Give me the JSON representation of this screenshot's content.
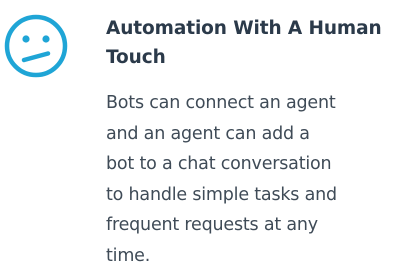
{
  "feature": {
    "icon": "confused-face-icon",
    "accent_color": "#1fa5d6",
    "title_lines": [
      "Automation With A Human",
      "Touch"
    ],
    "body_lines": [
      "Bots can connect an agent",
      "and an agent can add a",
      "bot to a chat conversation",
      "to handle simple tasks and",
      "frequent requests at any",
      "time."
    ]
  }
}
